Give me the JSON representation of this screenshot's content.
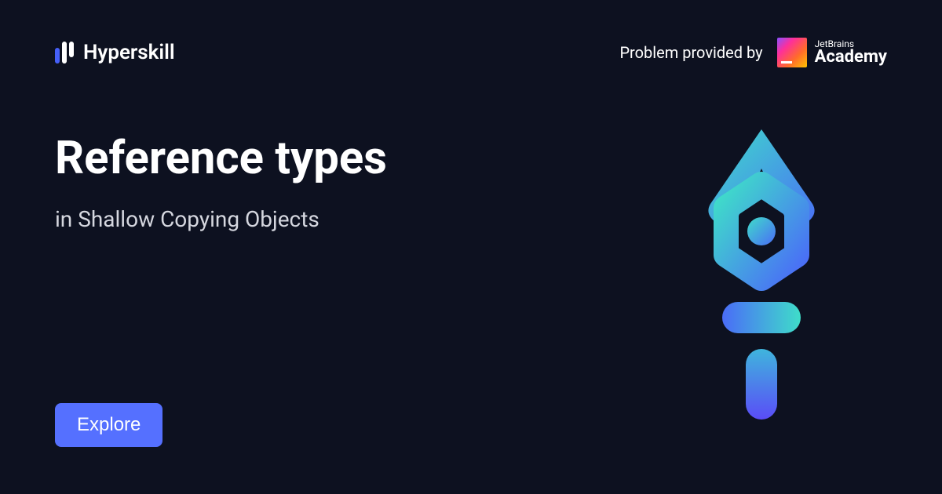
{
  "header": {
    "logo_text": "Hyperskill",
    "provider_text": "Problem provided by",
    "jetbrains_small": "JetBrains",
    "jetbrains_large": "Academy"
  },
  "main": {
    "title": "Reference types",
    "subtitle": "in Shallow Copying Objects"
  },
  "button": {
    "explore_label": "Explore"
  }
}
